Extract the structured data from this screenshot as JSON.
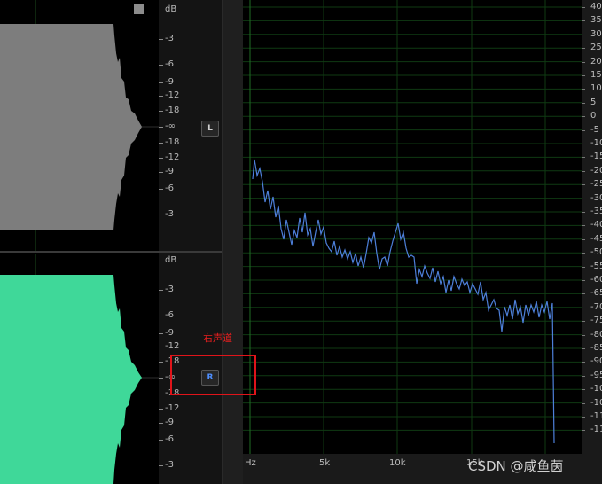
{
  "top_channel": {
    "db_header": "dB",
    "db_labels": [
      "-3",
      "-6",
      "-9",
      "-12",
      "-18",
      "-∞",
      "-18",
      "-12",
      "-9",
      "-6",
      "-3"
    ],
    "channel_button": "L",
    "wave_color": "#7d7d7d"
  },
  "bottom_channel": {
    "db_header": "dB",
    "db_labels": [
      "-3",
      "-6",
      "-9",
      "-12",
      "-18",
      "-∞",
      "-18",
      "-12",
      "-9",
      "-6",
      "-3"
    ],
    "channel_button": "R",
    "wave_color": "#3fd899"
  },
  "annotation": {
    "text": "右声道",
    "box_color": "#e0141a"
  },
  "spectrum": {
    "x_labels": [
      "Hz",
      "5k",
      "10k",
      "15k"
    ],
    "right_scale": [
      "40",
      "35",
      "30",
      "25",
      "20",
      "15",
      "10",
      "5",
      "0",
      "-5",
      "-10",
      "-15",
      "-20",
      "-25",
      "-30",
      "-35",
      "-40",
      "-45",
      "-50",
      "-55",
      "-60",
      "-65",
      "-70",
      "-75",
      "-80",
      "-85",
      "-90",
      "-95",
      "-100",
      "-105",
      "-110",
      "-115"
    ],
    "line_color": "#4d7fd9",
    "grid_color": "#0f3a12"
  },
  "watermark": "CSDN @咸鱼茵"
}
